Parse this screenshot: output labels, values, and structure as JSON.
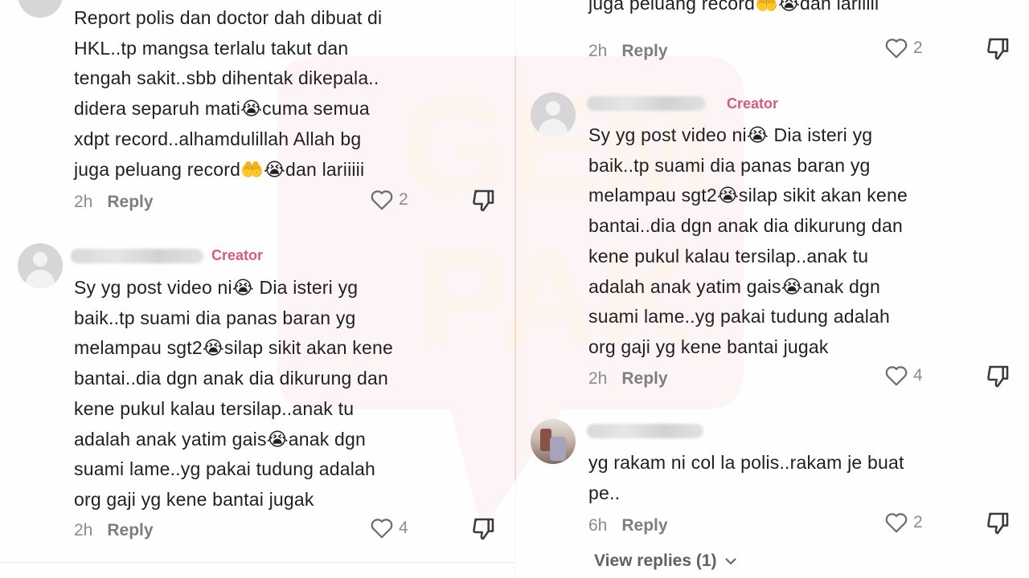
{
  "left_panel": {
    "comment1": {
      "text": "Report polis dan doctor dah dibuat di\nHKL..tp mangsa terlalu takut dan\ntengah sakit..sbb dihentak dikepala..\ndidera separuh mati😭cuma semua\nxdpt record..alhamdulillah Allah bg\njuga peluang record🤲😭dan lariiiii",
      "time": "2h",
      "reply_label": "Reply",
      "likes": "2"
    },
    "comment2": {
      "creator_label": "Creator",
      "text": "Sy yg post video ni😭 Dia isteri yg\nbaik..tp suami dia panas baran yg\nmelampau sgt2😭silap sikit akan kene\nbantai..dia dgn anak dia dikurung dan\nkene pukul kalau tersilap..anak tu\nadalah anak yatim gais😭anak dgn\nsuami lame..yg pakai tudung adalah\norg gaji yg kene bantai jugak",
      "time": "2h",
      "reply_label": "Reply",
      "likes": "4"
    }
  },
  "right_panel": {
    "comment1_tail": {
      "text": "juga peluang record🤲😭dan lariiiii",
      "time": "2h",
      "reply_label": "Reply",
      "likes": "2"
    },
    "comment2": {
      "creator_label": "Creator",
      "text": "Sy yg post video ni😭 Dia isteri yg\nbaik..tp suami dia panas baran yg\nmelampau sgt2😭silap sikit akan kene\nbantai..dia dgn anak dia dikurung dan\nkene pukul kalau tersilap..anak tu\nadalah anak yatim gais😭anak dgn\nsuami lame..yg pakai tudung adalah\norg gaji yg kene bantai jugak",
      "time": "2h",
      "reply_label": "Reply",
      "likes": "4"
    },
    "comment3": {
      "text": "yg rakam ni col la polis..rakam je buat\npe..",
      "time": "6h",
      "reply_label": "Reply",
      "likes": "2",
      "view_replies": "View replies (1)"
    }
  },
  "watermark": {
    "text_lines": [
      "GEM",
      "PAK"
    ],
    "color": "#f04545"
  },
  "colors": {
    "creator": "#d85b7b",
    "meta": "#8a8b91",
    "text": "#1f1f24"
  },
  "icons": [
    "heart-outline-icon",
    "dislike-icon",
    "chevron-down-icon",
    "avatar-placeholder-icon"
  ]
}
